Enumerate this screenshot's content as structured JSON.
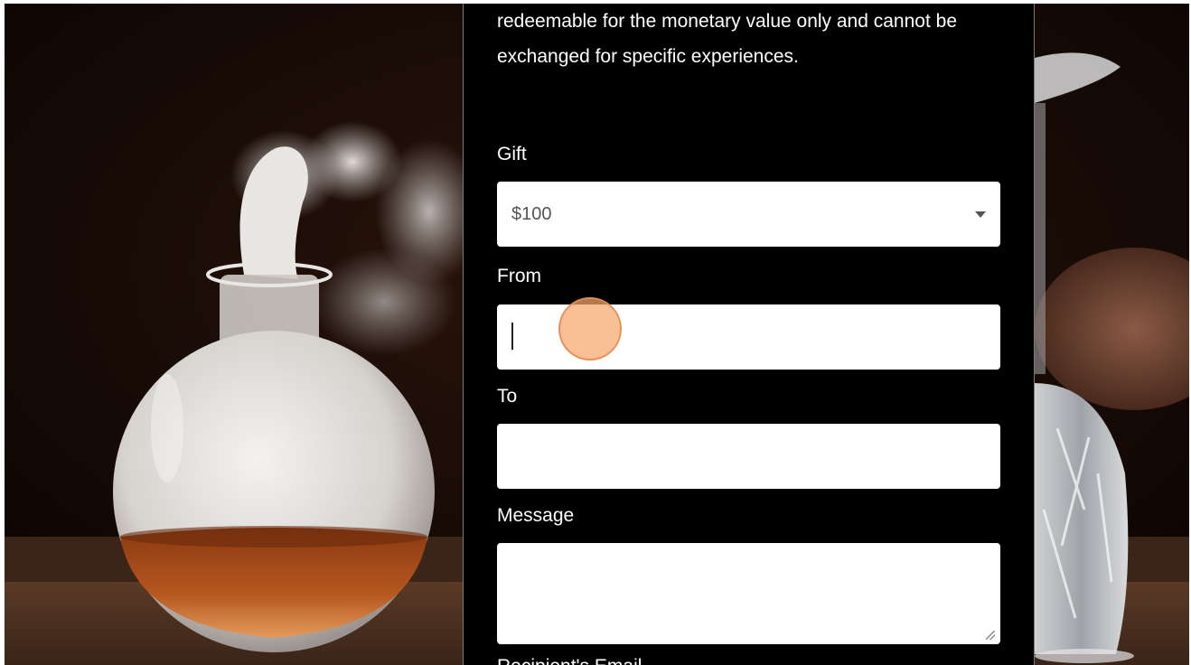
{
  "intro_text": "redeemable for the monetary value only and cannot be exchanged for specific experiences.",
  "form": {
    "gift": {
      "label": "Gift",
      "selected": "$100"
    },
    "from": {
      "label": "From",
      "value": ""
    },
    "to": {
      "label": "To",
      "value": ""
    },
    "message": {
      "label": "Message",
      "value": ""
    },
    "next_label_partial": "Recipient's Email"
  },
  "colors": {
    "panel_bg": "#000000",
    "field_bg": "#ffffff",
    "click_indicator": "#f7a86c"
  }
}
